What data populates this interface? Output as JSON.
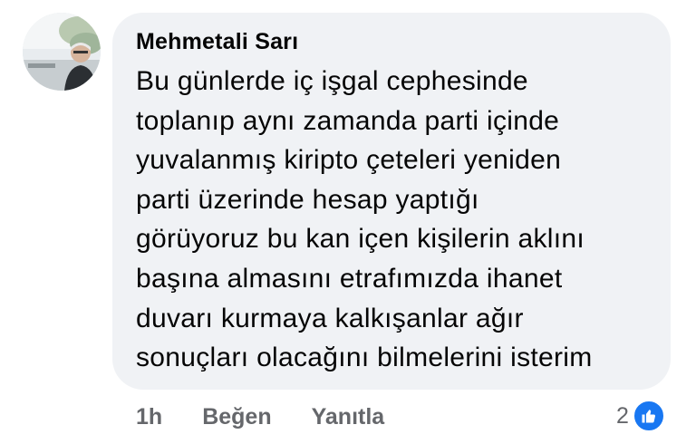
{
  "comment": {
    "author": "Mehmetali Sarı",
    "avatar_icon": "user-avatar-photo",
    "lines": [
      "Bu günlerde iç işgal cephesinde",
      "toplanıp aynı zamanda parti içinde",
      "yuvalanmış kiripto çeteleri yeniden",
      "parti üzerinde hesap yaptığı",
      "görüyoruz bu kan içen kişilerin aklını",
      "başına almasını etrafımızda ihanet",
      "duvarı kurmaya kalkışanlar ağır",
      "sonuçları olacağını bilmelerini isterim"
    ]
  },
  "actions": {
    "time": "1h",
    "like_label": "Beğen",
    "reply_label": "Yanıtla"
  },
  "reactions": {
    "count": "2",
    "icon": "thumbs-up-icon",
    "color": "#1877f2"
  },
  "colors": {
    "bubble": "#f0f2f5",
    "text": "#050505",
    "secondary": "#65676b"
  }
}
